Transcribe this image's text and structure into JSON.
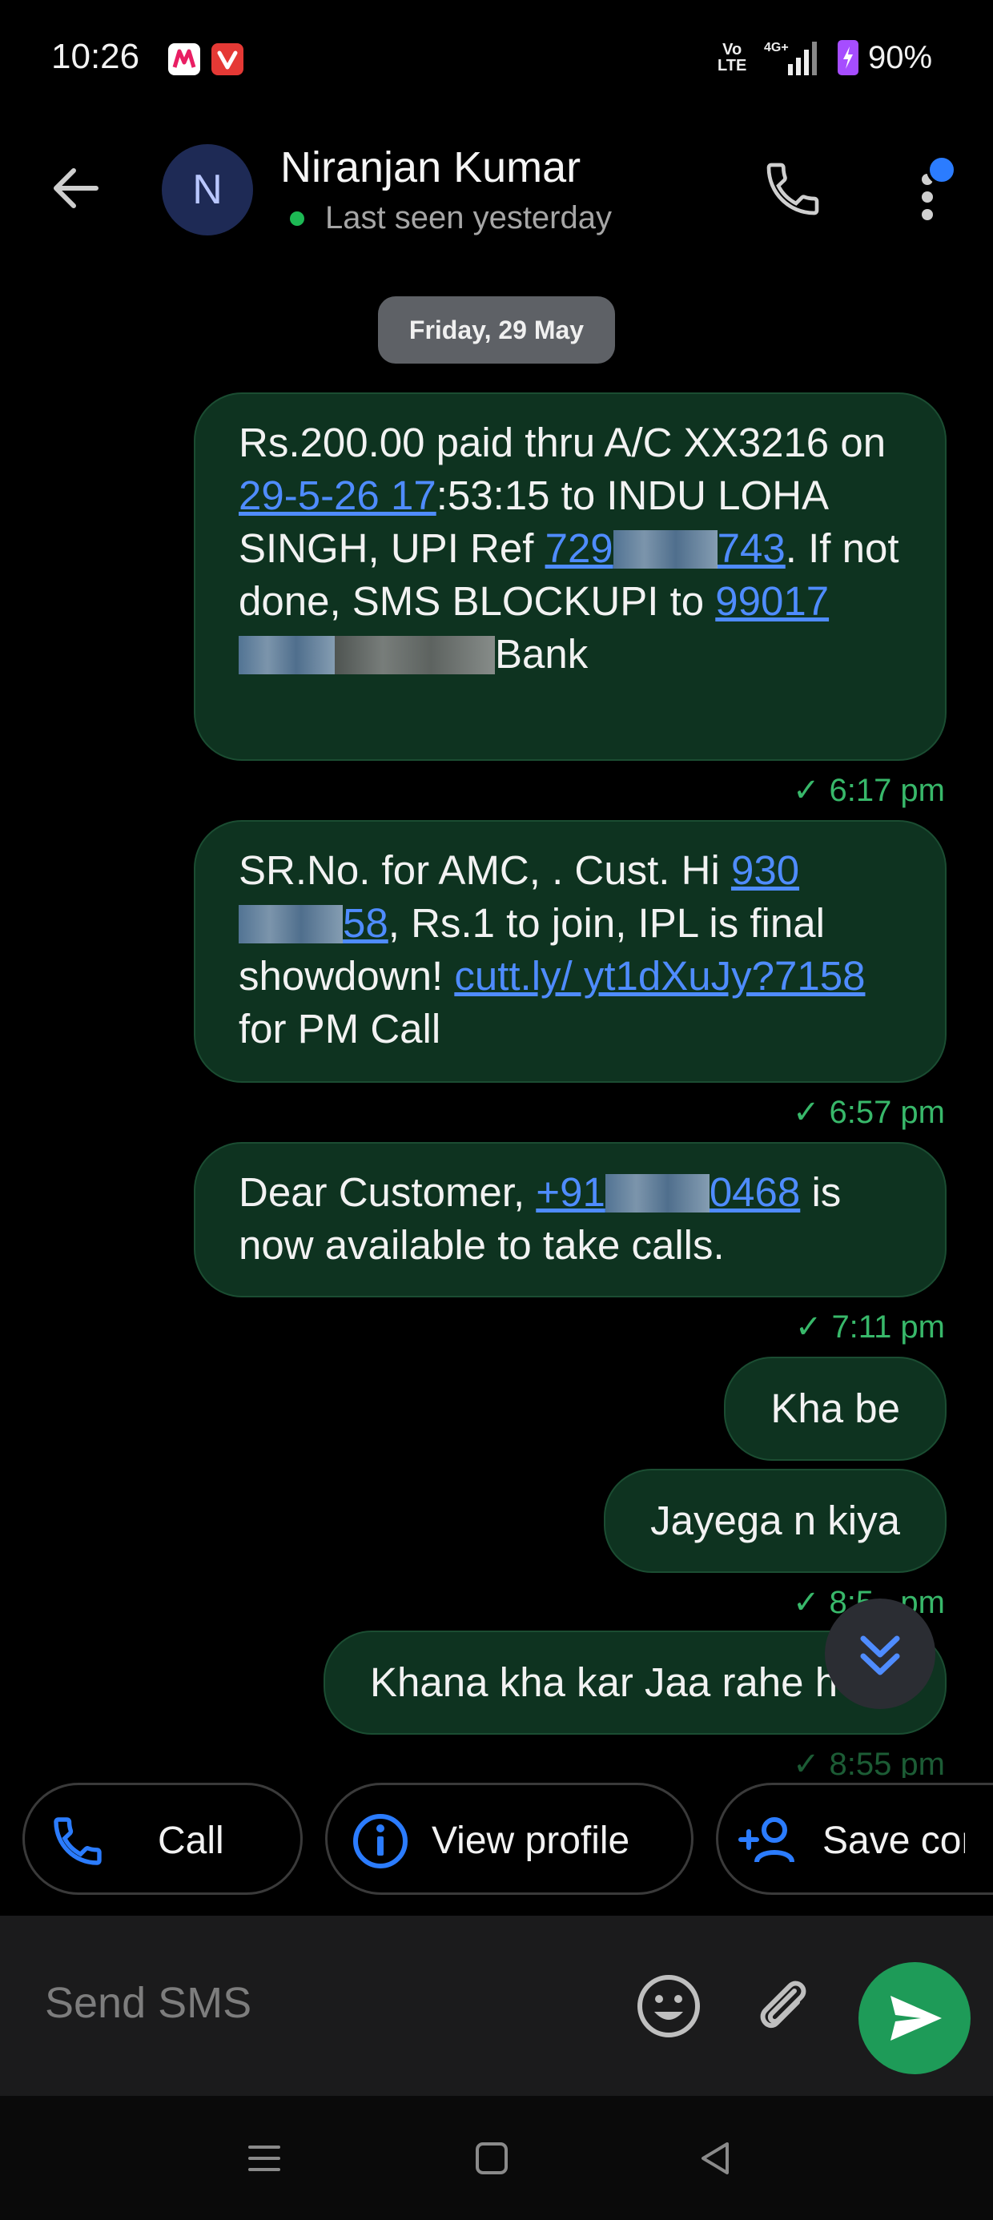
{
  "status_bar": {
    "time": "10:26",
    "volte": "Vo\nLTE",
    "network": "4G+",
    "battery": "90%"
  },
  "header": {
    "avatar_letter": "N",
    "name": "Niranjan Kumar",
    "presence": "Last seen yesterday"
  },
  "date_chip": "Friday, 29 May",
  "messages": [
    {
      "time": "6:17 pm",
      "p1": "Rs.200.00 paid thru A/C XX3216 on ",
      "link1": "29-5-26 17",
      "p2": ":53:15 to INDU LOHA SINGH, UPI Ref ",
      "link2a": "729",
      "link2b": "743",
      "p3": ". If not done, SMS BLOCKUPI to ",
      "link3": "99017",
      "p4": "Bank"
    },
    {
      "time": "6:57 pm",
      "p1": "SR.No.  for AMC, . Cust. Hi ",
      "link1a": "930",
      "link1b": "58",
      "p2": ", Rs.1 to join,  IPL is final showdown!  ",
      "link2": "cutt.ly/ yt1dXuJy?7158",
      "p3": " for PM Call"
    },
    {
      "time": "7:11 pm",
      "p1": "Dear Customer, ",
      "link1a": "+91",
      "link1b": "0468",
      "p2": " is now available to take calls."
    },
    {
      "text": "Kha be"
    },
    {
      "text": "Jayega n kiya",
      "time": "8:5_ pm"
    },
    {
      "text": "Khana kha kar Jaa rahe h",
      "time": "8:55 pm"
    }
  ],
  "quick_actions": {
    "call": "Call",
    "view_profile": "View profile",
    "save_contact": "Save contact"
  },
  "composer": {
    "placeholder": "Send SMS"
  },
  "colors": {
    "bubble": "#0e3320",
    "link": "#4f8cff",
    "accent_green": "#1e9b58",
    "timestamp": "#38b86a"
  }
}
